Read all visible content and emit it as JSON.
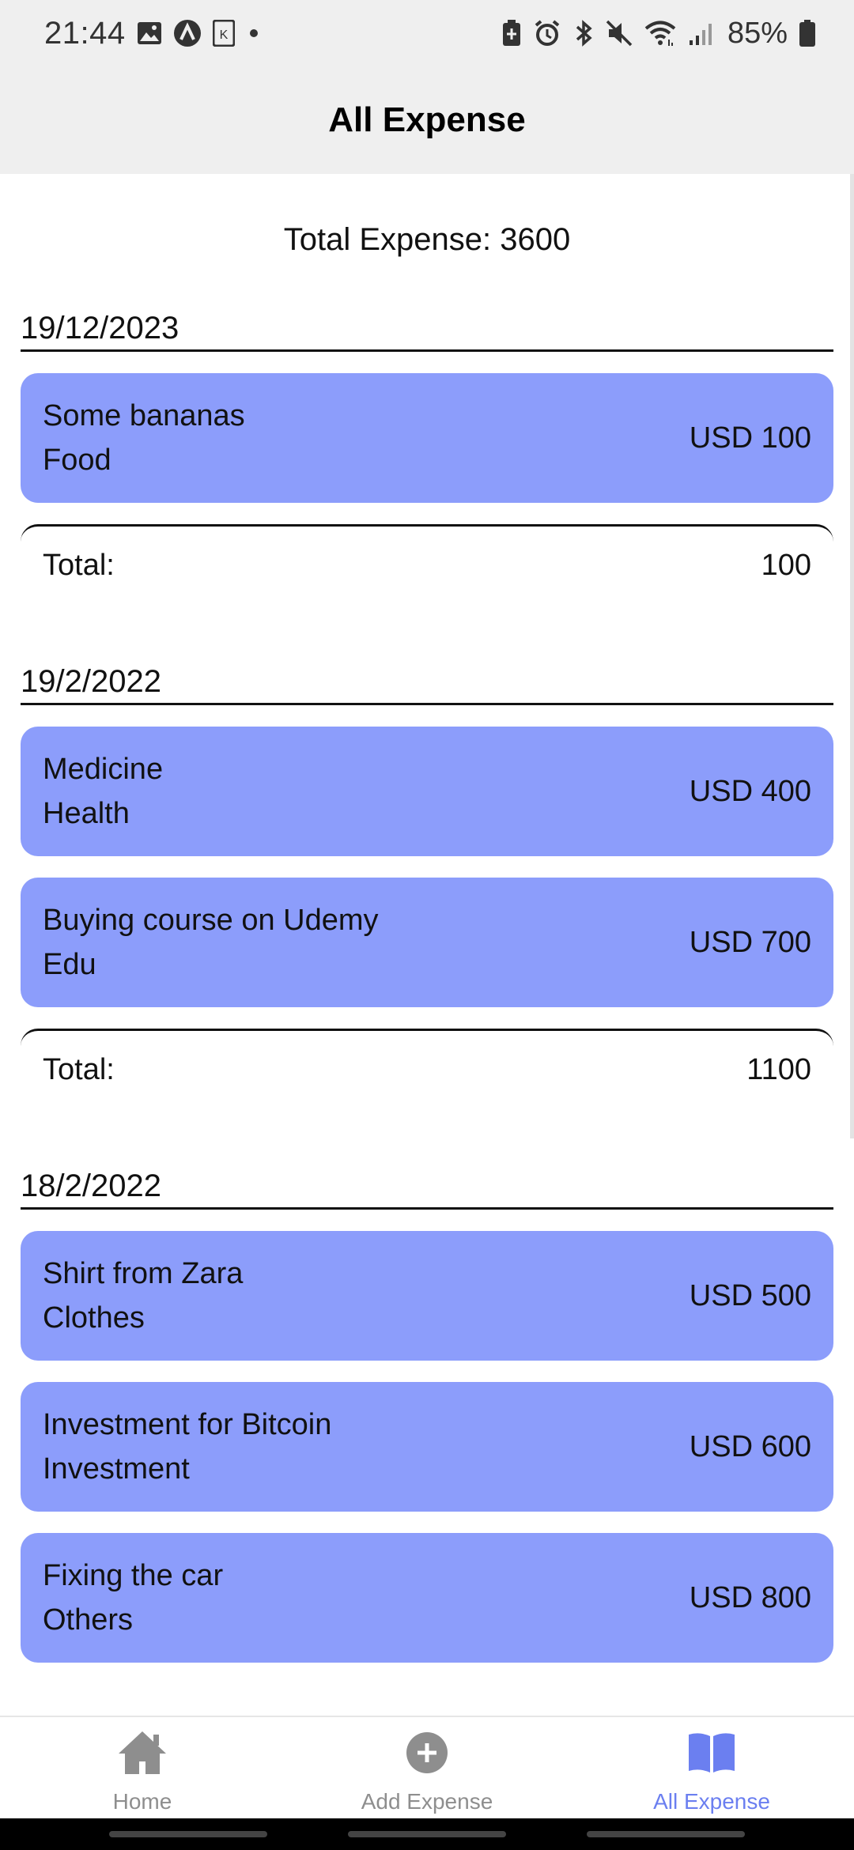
{
  "status_bar": {
    "time": "21:44",
    "battery": "85%",
    "icons_left": [
      "image-icon",
      "app-a-icon",
      "app-k-icon",
      "dot-icon"
    ],
    "icons_right": [
      "battery-saver-icon",
      "alarm-icon",
      "bluetooth-icon",
      "mute-icon",
      "wifi-icon",
      "signal-icon",
      "battery-icon"
    ]
  },
  "header": {
    "title": "All Expense"
  },
  "summary": {
    "total_text": "Total Expense: 3600"
  },
  "groups": [
    {
      "date": "19/12/2023",
      "items": [
        {
          "title": "Some bananas",
          "category": "Food",
          "amount": "USD 100"
        }
      ],
      "total_label": "Total:",
      "total_value": "100"
    },
    {
      "date": "19/2/2022",
      "items": [
        {
          "title": "Medicine",
          "category": "Health",
          "amount": "USD 400"
        },
        {
          "title": "Buying course on Udemy",
          "category": "Edu",
          "amount": "USD 700"
        }
      ],
      "total_label": "Total:",
      "total_value": "1100"
    },
    {
      "date": "18/2/2022",
      "items": [
        {
          "title": "Shirt from Zara",
          "category": "Clothes",
          "amount": "USD 500"
        },
        {
          "title": "Investment for Bitcoin",
          "category": "Investment",
          "amount": "USD 600"
        },
        {
          "title": "Fixing the car",
          "category": "Others",
          "amount": "USD 800"
        }
      ]
    }
  ],
  "bottom_nav": [
    {
      "label": "Home",
      "icon": "home-icon",
      "active": false
    },
    {
      "label": "Add Expense",
      "icon": "add-circle-icon",
      "active": false
    },
    {
      "label": "All Expense",
      "icon": "book-icon",
      "active": true
    }
  ],
  "colors": {
    "card": "#8c9dfb",
    "header_bg": "#efefef",
    "active_nav": "#6b7ff0",
    "inactive_nav": "#8e8e8e"
  }
}
